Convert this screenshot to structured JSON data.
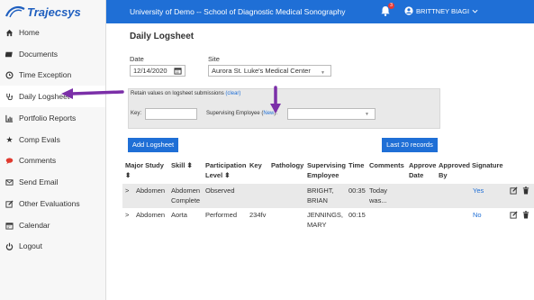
{
  "app": {
    "logo_text": "Trajecsys"
  },
  "topbar": {
    "breadcrumb": "University of Demo -- School of Diagnostic Medical Sonography",
    "notification_count": "3",
    "user_name": "BRITTNEY BIAGI"
  },
  "sidebar": {
    "items": [
      {
        "label": "Home",
        "icon": "home-icon"
      },
      {
        "label": "Documents",
        "icon": "document-icon"
      },
      {
        "label": "Time Exception",
        "icon": "clock-icon"
      },
      {
        "label": "Daily Logsheet",
        "icon": "stethoscope-icon"
      },
      {
        "label": "Portfolio Reports",
        "icon": "bar-chart-icon"
      },
      {
        "label": "Comp Evals",
        "icon": "star-icon"
      },
      {
        "label": "Comments",
        "icon": "comment-icon"
      },
      {
        "label": "Send Email",
        "icon": "envelope-icon"
      },
      {
        "label": "Other Evaluations",
        "icon": "edit-icon"
      },
      {
        "label": "Calendar",
        "icon": "calendar-icon"
      },
      {
        "label": "Logout",
        "icon": "power-icon"
      }
    ]
  },
  "main": {
    "title": "Daily Logsheet",
    "date_label": "Date",
    "date_value": "12/14/2020",
    "site_label": "Site",
    "site_value": "Aurora St. Luke's Medical Center",
    "retain_text": "Retain values on logsheet submissions",
    "clear_link": "(clear)",
    "key_label": "Key:",
    "supervising_label_prefix": "Supervising Employee (",
    "new_link": "New",
    "supervising_label_suffix": "):",
    "add_button": "Add Logsheet",
    "records_button": "Last 20 records"
  },
  "table": {
    "headers": {
      "major_study": "Major Study",
      "major_sort": "⬍",
      "skill": "Skill ⬍",
      "participation": "Participation",
      "participation_level": "Level ⬍",
      "key": "Key",
      "pathology": "Pathology",
      "supervising": "Supervising",
      "employee": "Employee",
      "time": "Time",
      "comments": "Comments",
      "approve": "Approve",
      "approve_date": "Date",
      "approved": "Approved",
      "approved_by": "By",
      "signature": "Signature"
    },
    "rows": [
      {
        "expand": ">",
        "major": "Abdomen",
        "skill_1": "Abdomen",
        "skill_2": "Complete",
        "participation": "Observed",
        "key": "",
        "sup_1": "BRIGHT,",
        "sup_2": "BRIAN",
        "time": "00:35",
        "comment_1": "Today",
        "comment_2": "was...",
        "signature": "Yes"
      },
      {
        "expand": ">",
        "major": "Abdomen",
        "skill_1": "Aorta",
        "skill_2": "",
        "participation": "Performed",
        "key": "234fv",
        "sup_1": "JENNINGS,",
        "sup_2": "MARY",
        "time": "00:15",
        "comment_1": "",
        "comment_2": "",
        "signature": "No"
      }
    ]
  },
  "colors": {
    "brand_blue": "#1f6fd6",
    "annotation_purple": "#7b2fa8",
    "badge_red": "#e53935"
  }
}
